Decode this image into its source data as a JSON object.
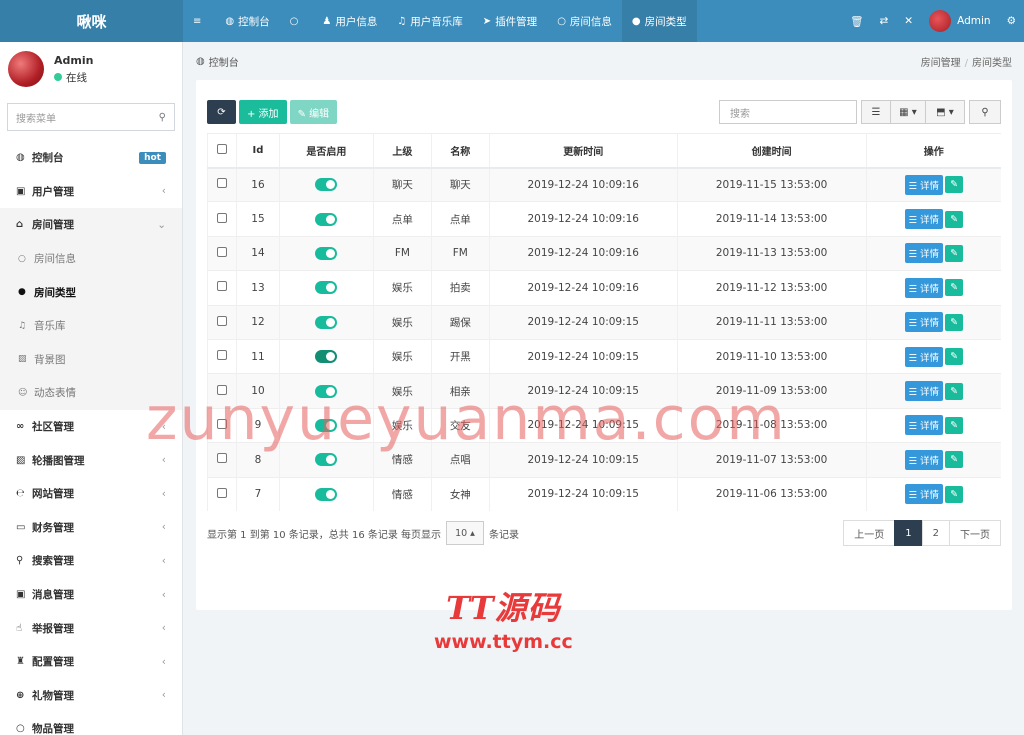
{
  "header": {
    "brand": "啾咪",
    "nav": [
      {
        "icon": "≡",
        "label": ""
      },
      {
        "icon": "◍",
        "label": "控制台"
      },
      {
        "icon": "○",
        "label": ""
      },
      {
        "icon": "♟",
        "label": "用户信息"
      },
      {
        "icon": "♫",
        "label": "用户音乐库"
      },
      {
        "icon": "➤",
        "label": "插件管理"
      },
      {
        "icon": "○",
        "label": "房间信息"
      },
      {
        "icon": "●",
        "label": "房间类型"
      }
    ],
    "right": {
      "trash": "🗑",
      "lang": "⇄",
      "fullscreen": "✕",
      "username": "Admin",
      "settings": "⚙"
    }
  },
  "sidebar": {
    "user": {
      "name": "Admin",
      "status": "在线"
    },
    "search_placeholder": "搜索菜单",
    "items": [
      {
        "icon": "◍",
        "label": "控制台",
        "badge": "hot"
      },
      {
        "icon": "▣",
        "label": "用户管理",
        "caret": "‹"
      },
      {
        "icon": "⌂",
        "label": "房间管理",
        "caret": "⌄"
      },
      {
        "icon": "○",
        "label": "房间信息"
      },
      {
        "icon": "●",
        "label": "房间类型"
      },
      {
        "icon": "♫",
        "label": "音乐库"
      },
      {
        "icon": "▨",
        "label": "背景图"
      },
      {
        "icon": "☺",
        "label": "动态表情"
      },
      {
        "icon": "∞",
        "label": "社区管理",
        "caret": "‹"
      },
      {
        "icon": "▨",
        "label": "轮播图管理",
        "caret": "‹"
      },
      {
        "icon": "℮",
        "label": "网站管理",
        "caret": "‹"
      },
      {
        "icon": "▭",
        "label": "财务管理",
        "caret": "‹"
      },
      {
        "icon": "⚲",
        "label": "搜索管理",
        "caret": "‹"
      },
      {
        "icon": "▣",
        "label": "消息管理",
        "caret": "‹"
      },
      {
        "icon": "☝",
        "label": "举报管理",
        "caret": "‹"
      },
      {
        "icon": "♜",
        "label": "配置管理",
        "caret": "‹"
      },
      {
        "icon": "⊕",
        "label": "礼物管理",
        "caret": "‹"
      },
      {
        "icon": "○",
        "label": "物品管理",
        "caret": ""
      }
    ]
  },
  "breadcrumb": {
    "home": "控制台",
    "path1": "房间管理",
    "path2": "房间类型"
  },
  "toolbar": {
    "refresh": "⟳",
    "add": "+ 添加",
    "edit": "✎ 编辑",
    "search_placeholder": "搜索",
    "view": "☰",
    "columns": "▦ ▾",
    "export": "⬒ ▾",
    "search_btn": "⚲"
  },
  "table": {
    "headers": [
      "",
      "Id",
      "是否启用",
      "上级",
      "名称",
      "更新时间",
      "创建时间",
      "操作"
    ],
    "rows": [
      {
        "id": "16",
        "parent": "聊天",
        "name": "聊天",
        "updated": "2019-12-24 10:09:16",
        "created": "2019-11-15 13:53:00",
        "dark": false
      },
      {
        "id": "15",
        "parent": "点单",
        "name": "点单",
        "updated": "2019-12-24 10:09:16",
        "created": "2019-11-14 13:53:00",
        "dark": false
      },
      {
        "id": "14",
        "parent": "FM",
        "name": "FM",
        "updated": "2019-12-24 10:09:16",
        "created": "2019-11-13 13:53:00",
        "dark": false
      },
      {
        "id": "13",
        "parent": "娱乐",
        "name": "拍卖",
        "updated": "2019-12-24 10:09:16",
        "created": "2019-11-12 13:53:00",
        "dark": false
      },
      {
        "id": "12",
        "parent": "娱乐",
        "name": "踢保",
        "updated": "2019-12-24 10:09:15",
        "created": "2019-11-11 13:53:00",
        "dark": false
      },
      {
        "id": "11",
        "parent": "娱乐",
        "name": "开黑",
        "updated": "2019-12-24 10:09:15",
        "created": "2019-11-10 13:53:00",
        "dark": true
      },
      {
        "id": "10",
        "parent": "娱乐",
        "name": "相亲",
        "updated": "2019-12-24 10:09:15",
        "created": "2019-11-09 13:53:00",
        "dark": false
      },
      {
        "id": "9",
        "parent": "娱乐",
        "name": "交友",
        "updated": "2019-12-24 10:09:15",
        "created": "2019-11-08 13:53:00",
        "dark": false
      },
      {
        "id": "8",
        "parent": "情感",
        "name": "点唱",
        "updated": "2019-12-24 10:09:15",
        "created": "2019-11-07 13:53:00",
        "dark": false
      },
      {
        "id": "7",
        "parent": "情感",
        "name": "女神",
        "updated": "2019-12-24 10:09:15",
        "created": "2019-11-06 13:53:00",
        "dark": false
      }
    ],
    "detail_label": "☰ 详情",
    "edit_label": "✎"
  },
  "footer": {
    "info_prefix": "显示第 1 到第 10 条记录，总共 16 条记录 每页显示",
    "page_size": "10 ▴",
    "info_suffix": "条记录",
    "pager": [
      "上一页",
      "1",
      "2",
      "下一页"
    ]
  },
  "watermarks": {
    "main": "zunyueyuanma.com",
    "logo": "TT源码",
    "url": "www.ttym.cc"
  }
}
